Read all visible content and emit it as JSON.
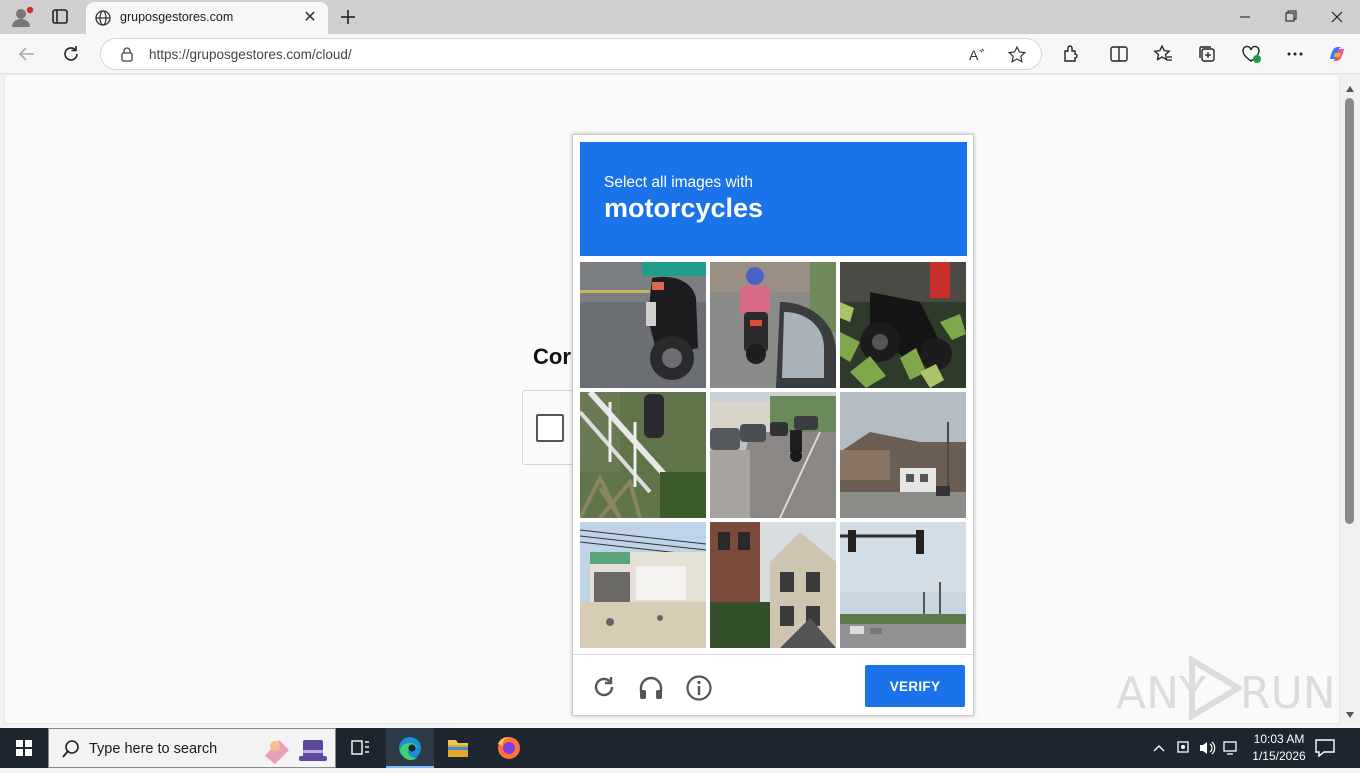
{
  "browser": {
    "tab_title": "gruposgestores.com",
    "url": "https://gruposgestores.com/cloud/",
    "read_aloud_label": "A̅"
  },
  "page": {
    "background_heading": "Cor"
  },
  "captcha": {
    "instruction": "Select all images with",
    "target": "motorcycles",
    "verify_label": "VERIFY",
    "accent_color": "#1a73e8",
    "tiles": [
      "motorcycle rear wheel on road",
      "delivery rider on motorcycle",
      "motorcycle in plants",
      "porch stairs with plants",
      "street with parked cars and motorcycle",
      "buildings under cloudy sky",
      "storefront building",
      "brick houses",
      "traffic lights over road"
    ]
  },
  "watermark": {
    "left": "ANY",
    "right": "RUN"
  },
  "taskbar": {
    "search_placeholder": "Type here to search",
    "time": "10:03 AM",
    "date": "1/15/2026"
  }
}
